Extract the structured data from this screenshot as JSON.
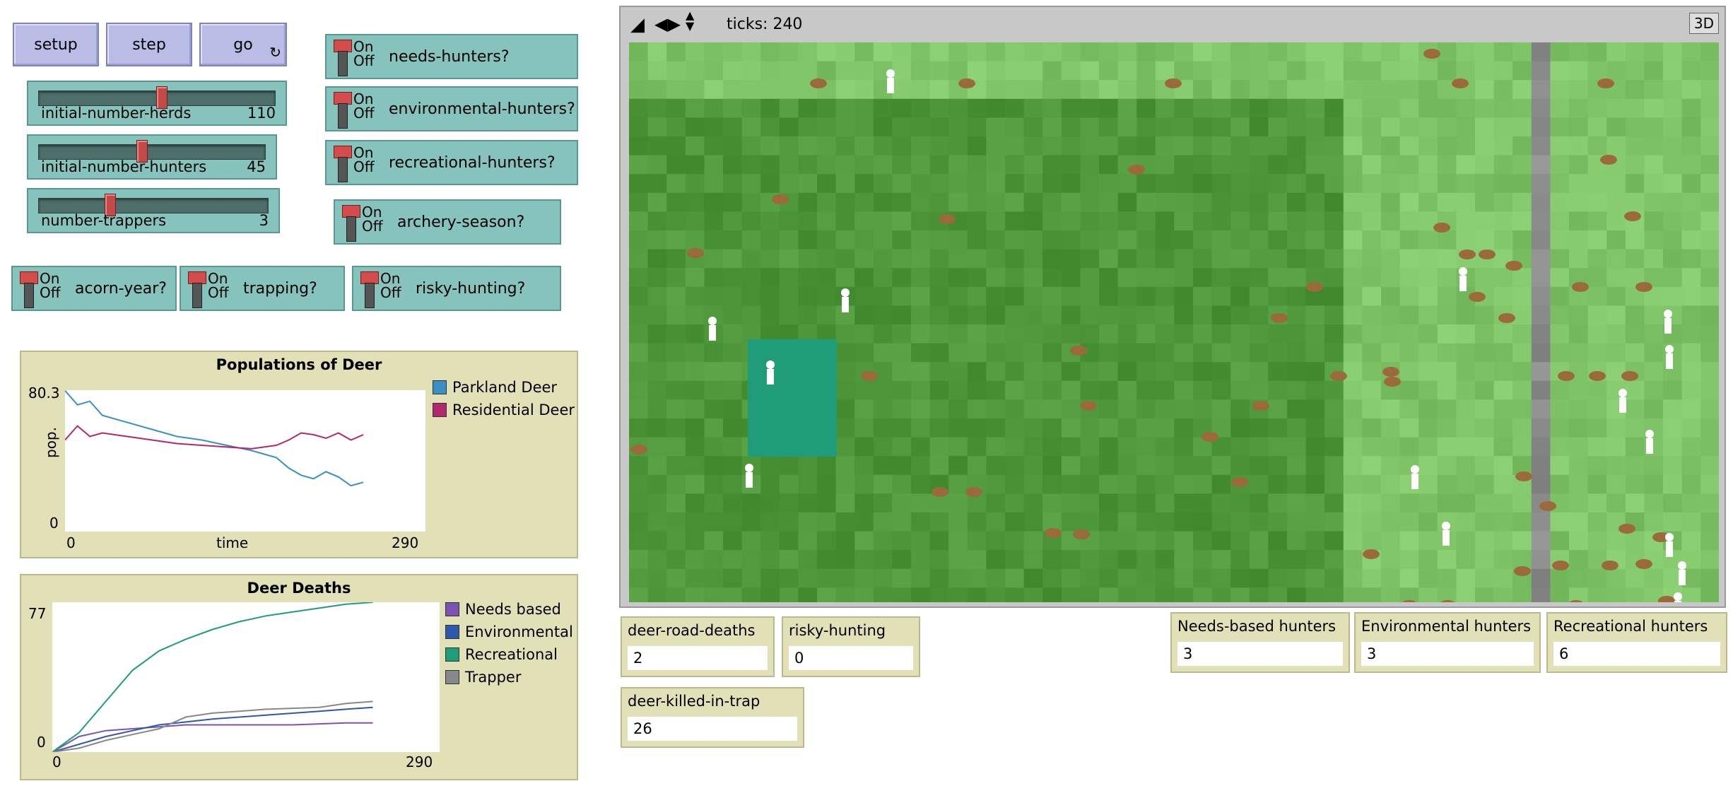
{
  "buttons": {
    "setup": "setup",
    "step": "step",
    "go": "go"
  },
  "sliders": [
    {
      "name": "initial-number-herds",
      "value": "110",
      "fraction": 0.52
    },
    {
      "name": "initial-number-hunters",
      "value": "45",
      "fraction": 0.45
    },
    {
      "name": "number-trappers",
      "value": "3",
      "fraction": 0.3
    }
  ],
  "switches": {
    "on_label": "On",
    "off_label": "Off",
    "needs_hunters": "needs-hunters?",
    "environmental_hunters": "environmental-hunters?",
    "recreational_hunters": "recreational-hunters?",
    "archery_season": "archery-season?",
    "acorn_year": "acorn-year?",
    "trapping": "trapping?",
    "risky_hunting": "risky-hunting?"
  },
  "view": {
    "ticks_label": "ticks: 240",
    "three_d": "3D"
  },
  "monitors": {
    "deer_road_deaths": {
      "label": "deer-road-deaths",
      "value": "2"
    },
    "risky_hunting": {
      "label": "risky-hunting",
      "value": "0"
    },
    "deer_killed_in_trap": {
      "label": "deer-killed-in-trap",
      "value": "26"
    },
    "needs_based_hunters": {
      "label": "Needs-based hunters",
      "value": "3"
    },
    "environmental_hunters": {
      "label": "Environmental hunters",
      "value": "3"
    },
    "recreational_hunters": {
      "label": "Recreational hunters",
      "value": "6"
    }
  },
  "colors": {
    "parkland": "#3a8fc4",
    "residential": "#b3286d",
    "needs": "#7a55b0",
    "environmental": "#2f58a8",
    "recreational": "#1f9c78",
    "trapper": "#888888"
  },
  "chart_data": [
    {
      "type": "line",
      "title": "Populations of Deer",
      "xlabel": "time",
      "ylabel": "pop.",
      "xlim": [
        0,
        290
      ],
      "ylim": [
        0,
        80.3
      ],
      "x_tick_labels": [
        "0",
        "290"
      ],
      "y_tick_labels": [
        "0",
        "80.3"
      ],
      "series": [
        {
          "name": "Parkland Deer",
          "x": [
            0,
            10,
            20,
            30,
            50,
            70,
            90,
            110,
            130,
            150,
            170,
            180,
            190,
            200,
            210,
            220,
            230,
            240
          ],
          "y": [
            80,
            72,
            74,
            66,
            62,
            58,
            54,
            52,
            49,
            46,
            42,
            36,
            32,
            30,
            34,
            31,
            26,
            28
          ]
        },
        {
          "name": "Residential Deer",
          "x": [
            0,
            10,
            20,
            30,
            50,
            70,
            90,
            110,
            130,
            150,
            170,
            180,
            190,
            200,
            210,
            220,
            230,
            240
          ],
          "y": [
            52,
            60,
            54,
            56,
            54,
            52,
            50,
            49,
            48,
            47,
            49,
            52,
            56,
            55,
            53,
            56,
            52,
            55
          ]
        }
      ]
    },
    {
      "type": "line",
      "title": "Deer Deaths",
      "xlim": [
        0,
        290
      ],
      "ylim": [
        0,
        77
      ],
      "x_tick_labels": [
        "0",
        "290"
      ],
      "y_tick_labels": [
        "0",
        "77"
      ],
      "series": [
        {
          "name": "Needs based",
          "x": [
            0,
            20,
            40,
            60,
            80,
            100,
            140,
            180,
            220,
            240
          ],
          "y": [
            0,
            8,
            11,
            12,
            13,
            14,
            14,
            14,
            15,
            15
          ]
        },
        {
          "name": "Environmental",
          "x": [
            0,
            20,
            40,
            60,
            80,
            120,
            160,
            200,
            220,
            240
          ],
          "y": [
            0,
            4,
            8,
            11,
            14,
            17,
            19,
            21,
            22,
            23
          ]
        },
        {
          "name": "Recreational",
          "x": [
            0,
            20,
            40,
            60,
            80,
            100,
            120,
            140,
            160,
            180,
            200,
            220,
            240
          ],
          "y": [
            0,
            10,
            26,
            42,
            52,
            58,
            63,
            67,
            70,
            72,
            74,
            76,
            77
          ]
        },
        {
          "name": "Trapper",
          "x": [
            0,
            20,
            40,
            60,
            80,
            100,
            120,
            140,
            160,
            200,
            220,
            240
          ],
          "y": [
            0,
            2,
            6,
            9,
            12,
            18,
            20,
            21,
            22,
            23,
            25,
            26
          ]
        }
      ]
    }
  ]
}
